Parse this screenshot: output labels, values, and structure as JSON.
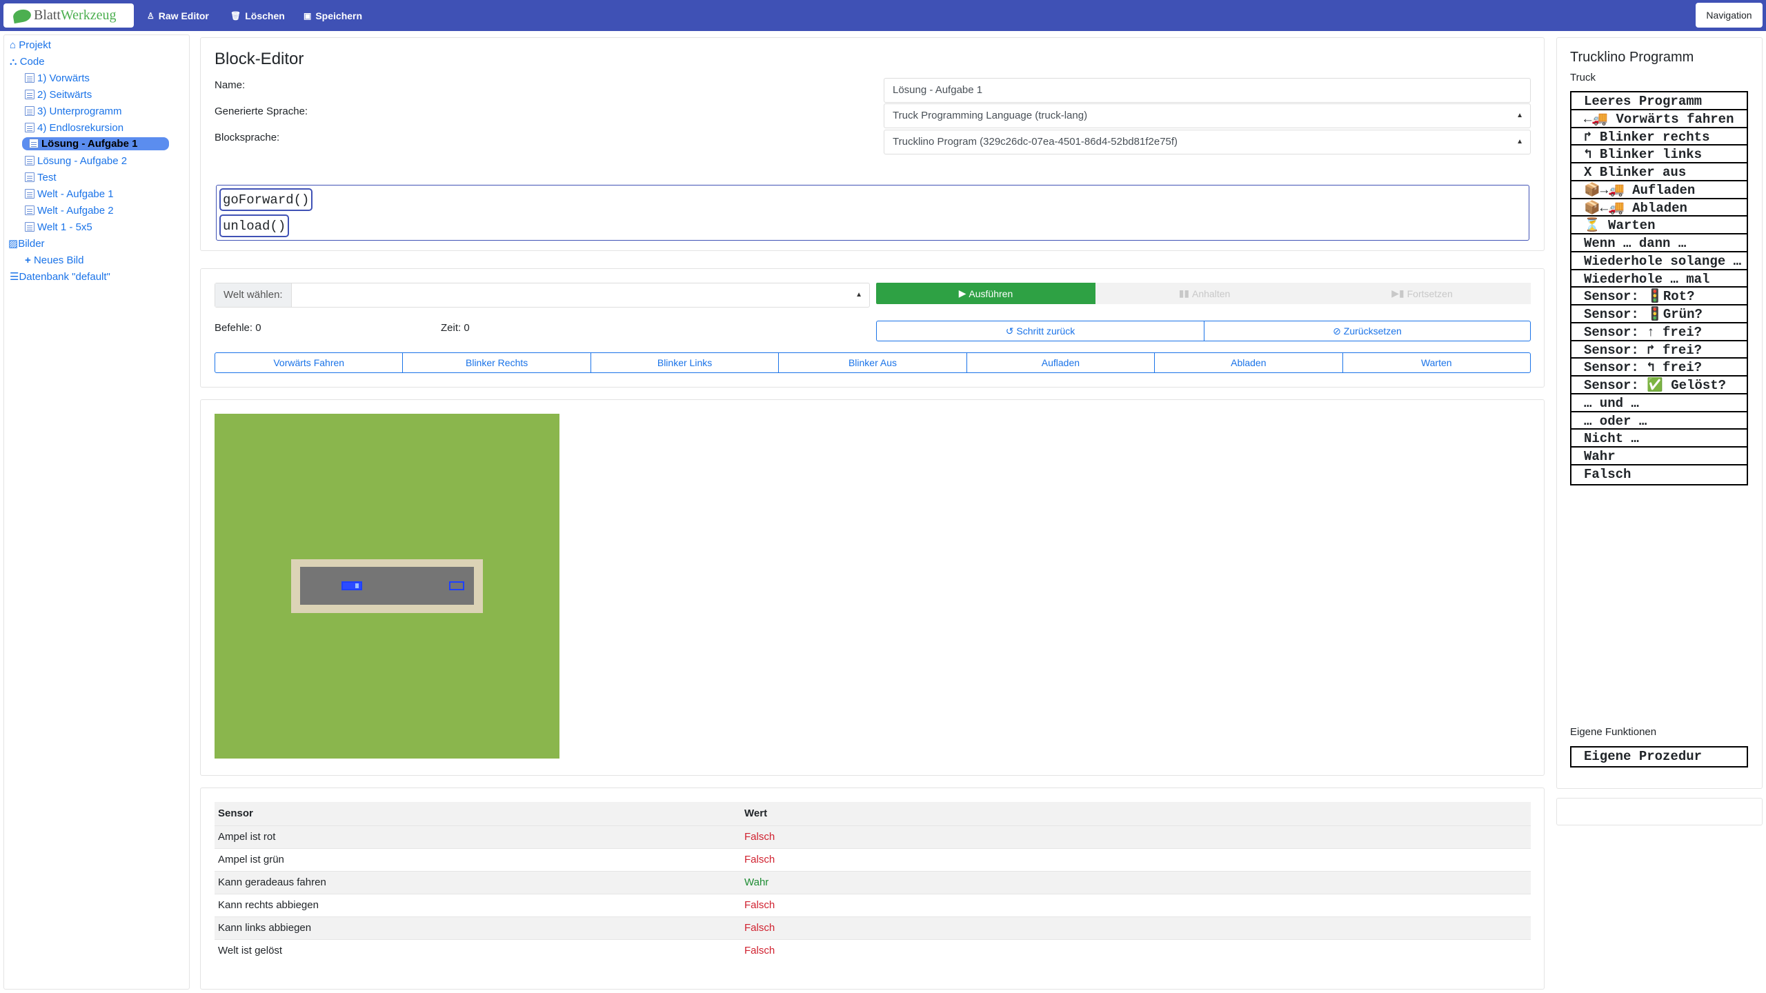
{
  "app": {
    "brand_part1": "Blatt",
    "brand_part2": "Werkzeug",
    "nav": {
      "raw_editor": "Raw Editor",
      "delete": "Löschen",
      "save": "Speichern",
      "navigation": "Navigation"
    }
  },
  "sidebar": {
    "project": "Projekt",
    "code": "Code",
    "code_items": [
      "1) Vorwärts",
      "2) Seitwärts",
      "3) Unterprogramm",
      "4) Endlosrekursion",
      "Lösung - Aufgabe 1",
      "Lösung - Aufgabe 2",
      "Test",
      "Welt - Aufgabe 1",
      "Welt - Aufgabe 2",
      "Welt 1 - 5x5"
    ],
    "active_item": "Lösung - Aufgabe 1",
    "images": "Bilder",
    "new_image": "Neues Bild",
    "database": "Datenbank \"default\""
  },
  "editor": {
    "title": "Block-Editor",
    "name_label": "Name:",
    "name_value": "Lösung - Aufgabe 1",
    "lang_label": "Generierte Sprache:",
    "lang_value": "Truck Programming Language (truck-lang)",
    "block_lang_label": "Blocksprache:",
    "block_lang_value": "Trucklino Program (329c26dc-07ea-4501-86d4-52bd81f2e75f)",
    "blocks": [
      "goForward()",
      "unload()"
    ]
  },
  "controls": {
    "world_label": "Welt wählen:",
    "world_value": "",
    "run": "Ausführen",
    "pause": "Anhalten",
    "resume": "Fortsetzen",
    "commands_label": "Befehle: 0",
    "time_label": "Zeit: 0",
    "step_back": "Schritt zurück",
    "reset": "Zurücksetzen",
    "actions": [
      "Vorwärts Fahren",
      "Blinker Rechts",
      "Blinker Links",
      "Blinker Aus",
      "Aufladen",
      "Abladen",
      "Warten"
    ]
  },
  "sensors": {
    "col_sensor": "Sensor",
    "col_value": "Wert",
    "rows": [
      {
        "name": "Ampel ist rot",
        "value": "Falsch",
        "ok": false
      },
      {
        "name": "Ampel ist grün",
        "value": "Falsch",
        "ok": false
      },
      {
        "name": "Kann geradeaus fahren",
        "value": "Wahr",
        "ok": true
      },
      {
        "name": "Kann rechts abbiegen",
        "value": "Falsch",
        "ok": false
      },
      {
        "name": "Kann links abbiegen",
        "value": "Falsch",
        "ok": false
      },
      {
        "name": "Welt ist gelöst",
        "value": "Falsch",
        "ok": false
      }
    ]
  },
  "toolbox": {
    "title": "Trucklino Programm",
    "section_truck": "Truck",
    "blocks": [
      "Leeres Programm",
      "←🚚 Vorwärts fahren",
      "↱ Blinker rechts",
      "↰ Blinker links",
      "X Blinker aus",
      "📦→🚚 Aufladen",
      "📦←🚚 Abladen",
      "⏳ Warten",
      "Wenn … dann …",
      "Wiederhole solange …",
      "Wiederhole … mal",
      "Sensor: 🚦Rot?",
      "Sensor: 🚦Grün?",
      "Sensor: ↑ frei?",
      "Sensor: ↱ frei?",
      "Sensor: ↰ frei?",
      "Sensor: ✅ Gelöst?",
      "… und …",
      "… oder …",
      "Nicht …",
      "Wahr",
      "Falsch"
    ],
    "section_custom": "Eigene Funktionen",
    "custom_blocks": [
      "Eigene Prozedur"
    ]
  }
}
